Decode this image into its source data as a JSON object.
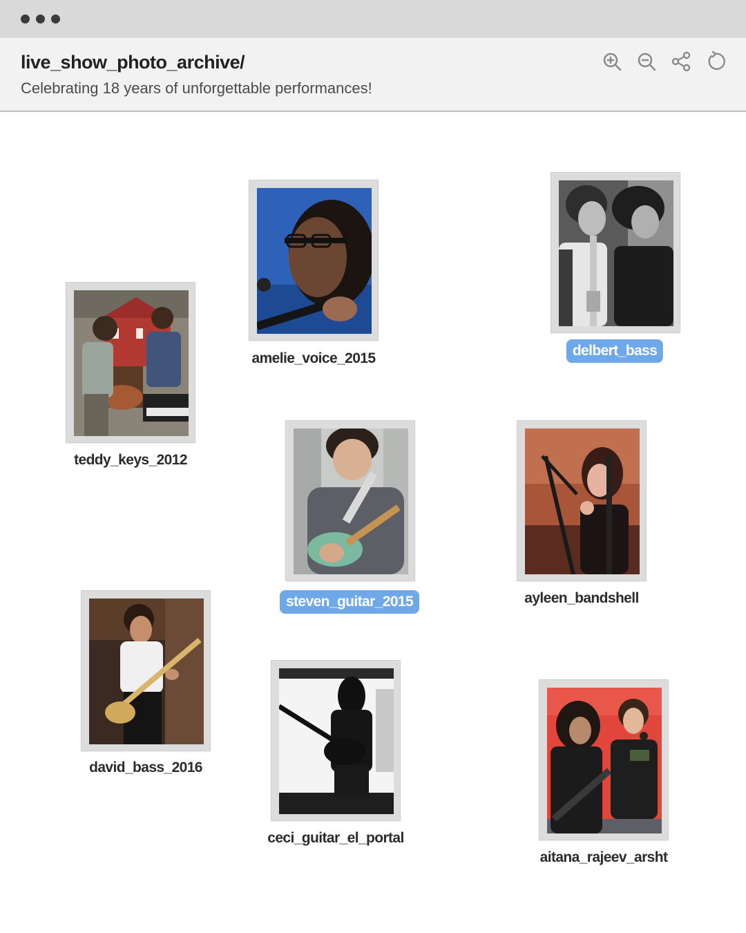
{
  "window": {
    "title": "live_show_photo_archive/",
    "subtitle": "Celebrating 18 years of unforgettable performances!"
  },
  "toolbar": {
    "icons": [
      "zoom-in-icon",
      "zoom-out-icon",
      "share-icon",
      "refresh-icon"
    ]
  },
  "photos": [
    {
      "label": "teddy_keys_2012",
      "selected": false
    },
    {
      "label": "amelie_voice_2015",
      "selected": false
    },
    {
      "label": "delbert_bass",
      "selected": true
    },
    {
      "label": "steven_guitar_2015",
      "selected": true
    },
    {
      "label": "ayleen_bandshell",
      "selected": false
    },
    {
      "label": "david_bass_2016",
      "selected": false
    },
    {
      "label": "ceci_guitar_el_portal",
      "selected": false
    },
    {
      "label": "aitana_rajeev_arsht",
      "selected": false
    }
  ],
  "colors": {
    "selection": "#6ea8e8",
    "titlebar": "#d9d9d9",
    "header": "#f2f2f2"
  }
}
